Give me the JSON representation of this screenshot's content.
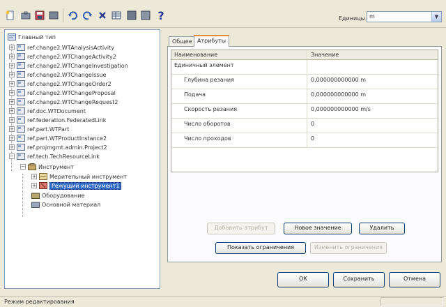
{
  "toolbar": {
    "units_label": "Единицы",
    "units_value": "m",
    "buttons": [
      "new-icon",
      "toolbox-icon",
      "save-icon",
      "sheet-icon",
      "undo-icon",
      "redo-icon",
      "delete-icon",
      "table-icon",
      "grid-icon",
      "grid-alt-icon",
      "help-icon"
    ],
    "help_glyph": "?"
  },
  "tree": {
    "root": "Главный тип",
    "items": [
      "ref.change2.WTAnalysisActivity",
      "ref.change2.WTChangeActivity2",
      "ref.change2.WTChangeInvestigation",
      "ref.change2.WTChangeIssue",
      "ref.change2.WTChangeOrder2",
      "ref.change2.WTChangeProposal",
      "ref.change2.WTChangeRequest2",
      "ref.doc.WTDocument",
      "ref.federation.FederatedLink",
      "ref.part.WTPart",
      "ref.part.WTProductInstance2",
      "ref.projmgmt.admin.Project2",
      "ref.tech.TechResourceLink"
    ],
    "group": "Инструмент",
    "group_children": [
      "Мерительный инструмент",
      "Режущий инструмент1"
    ],
    "siblings": [
      "Оборудование",
      "Основной материал"
    ]
  },
  "tabs": [
    "Общее",
    "Атрибуты"
  ],
  "grid": {
    "headers": [
      "Наименование",
      "Значение"
    ],
    "rows": [
      {
        "name": "Единичный элемент",
        "value": "",
        "child": false
      },
      {
        "name": "Глубина резания",
        "value": "0,000000000000 m",
        "child": true
      },
      {
        "name": "Подача",
        "value": "0,000000000000 m",
        "child": true
      },
      {
        "name": "Скорость резания",
        "value": "0,000000000000 m/s",
        "child": true
      },
      {
        "name": "Число оборотов",
        "value": "0",
        "child": true
      },
      {
        "name": "Число проходов",
        "value": "0",
        "child": true
      }
    ]
  },
  "buttons": {
    "add_attribute": "Добавить атрибут",
    "new_value": "Новое значение",
    "remove": "Удалить",
    "show_constraints": "Показать ограничения",
    "change_constraints": "Изменить ограничения",
    "ok": "ОК",
    "save": "Сохранить",
    "cancel": "Отмена"
  },
  "status_bar": {
    "text": "Режим редактирования"
  },
  "colors": {
    "selection": "#316ac5",
    "window_bg": "#ece9d8"
  }
}
